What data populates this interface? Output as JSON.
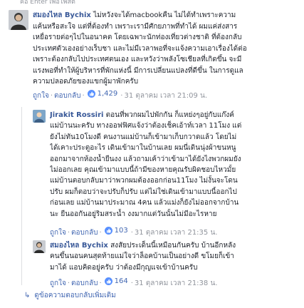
{
  "top_fragment": "คอ Enter เพื่อโพสต์",
  "comments": [
    {
      "name": "สมองไหล Bychix",
      "lines": [
        "ไม่หวังจะได้macbookคืน ไม่ได้ทำเพราะความ",
        "แค้นหรือสะใจ แต่ที่ต้องทำ เพราะเรามีศักยภาพที่ทำได้ ผมแค่ส่งสาร",
        "เหยื่อรายต่อๆไปในอนาคต โดยเฉพาะนักท่องเที่ยวต่างชาติ ที่ต้องกลับ",
        "ประเทศตัวเองอย่างเร็บชา และไม่มีเวลาพอที่จะแจ้งความเอาเรื่องได้ต่อ",
        "เพราะต้องกลับไปประเทศตนเอง และหวังว่าพลังโซเชียลที่เกิดขึ้น จะมี",
        "แรงพอที่ทำให้ผู้บริหารที่พักแห่งนี้ มีการเปลี่ยนแปลงที่ดีขึ้น ในการดูแล",
        "ความปลอดภัยของแขกผู้มาพักครับ"
      ],
      "like": "ถูกใจ",
      "reply": "ตอบกลับ",
      "reactions": "1,429",
      "time": "31 ตุลาคม เวลา 21:09 น."
    },
    {
      "name": "Jirakit Rossiri",
      "lines": [
        "ตอนที่พวกผมไปพักกัน ก็แหย่งๆอยู่กับแก๊งค์",
        "แม่บ้านนะครับ ทางออฟฟิศแจ้งว่าต้องเช็คเอ้าท์เวลา 11โมง แต่",
        "ยังไม่ทัน10โมงดี คนงานแม่บ้านก็เข้ามาเก็บกวาดแล้ว โดยไม่",
        "ได้เคาะประตูอะไร เดินเข้ามาในบ้านเลย ผมนี่เดินนุ่งผ้าขนหนู",
        "ออกมาจากห้องน้ำยืนงง แล้วถามเค้าว่าเข้ามาได้ยังไงพวกผมยัง",
        "ไม่ออกเลย คุณเข้ามาแบบนี้ถ้ามีของหายคุณรับผิดชอบไหวมั้ย",
        "แม่บ้านตอบกลับมาว่าพวกผมต้องออกก่อน11โมง ไม่งั้นจะโดน",
        "ปรับ ผมก็ตอบว่าจะปรับก็ปรับ แต่ไม่ใช่เดินเข้ามาแบบนี้ออกไป",
        "ก่อนเลย แม่บ้านมาประมาณ 4คน แล้วแม่งก็ยังไม่ออกจากบ้าน",
        "นะ ยืนออกันอยู่ริมสระน้ำ งงมากแต่วันนั้นไม่มีอะไรหาย"
      ],
      "like": "ถูกใจ",
      "reply": "ตอบกลับ",
      "reactions": "103",
      "time": "31 ตุลาคม เวลา 21:35 น."
    },
    {
      "name": "สมองไหล Bychix",
      "lines": [
        "สงสัยประเด็นนี้เหมือนกันครับ บ้านอีกหลัง",
        "คนขึ้นนอนคนสุดท้ายแม่ใจว่าล็อคบ้านเป็นอย่างดี ขโมยก็เข้า",
        "มาได้ แอบคิดอยู่ครับ ว่าต้องมีกุญแจเข้าบ้านครับ"
      ],
      "like": "ถูกใจ",
      "reply": "ตอบกลับ",
      "reactions": "164",
      "time": "31 ตุลาคม เวลา 21:38 น."
    }
  ],
  "view_more": "ดูข้อความตอบกลับเพิ่มเติม",
  "colors": {
    "name": "#385898",
    "link": "#4267b2",
    "muted": "#90949c",
    "like": "#5890ff"
  }
}
